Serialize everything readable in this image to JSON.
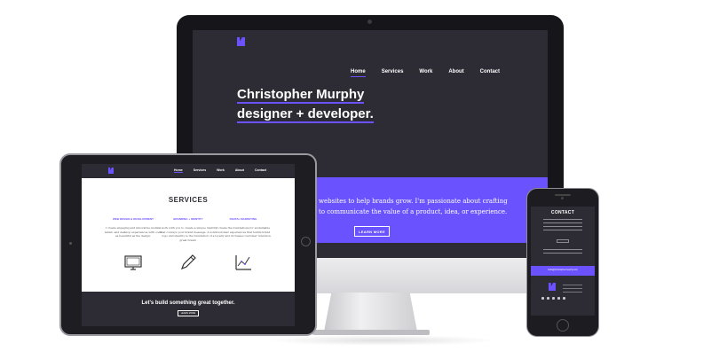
{
  "desktop": {
    "nav": [
      "Home",
      "Services",
      "Work",
      "About",
      "Contact"
    ],
    "hero_line1": "Christopher Murphy",
    "hero_line2": "designer + developer.",
    "band_line1": "websites to help brands grow. I'm passionate about crafting",
    "band_line2": "to communicate the value of a product, idea, or experience.",
    "button": "LEARN MORE"
  },
  "tablet": {
    "nav": [
      "Home",
      "Services",
      "Work",
      "About",
      "Contact"
    ],
    "section_title": "SERVICES",
    "services": [
      {
        "heading": "WEB DESIGN & DEVELOPMENT",
        "text": "I create engaging and innovative mobile, tablet, and desktop experiences with code as beautiful as the design.",
        "icon": "monitor-icon"
      },
      {
        "heading": "BRANDING + IDENTITY",
        "text": "I work with you to create a unique identity that conveys your brand message. A solid logo and identity is the foundation of a great brand.",
        "icon": "pencil-icon"
      },
      {
        "heading": "DIGITAL MARKETING",
        "text": "I create the foundations for sustainable customer experiences that builds brand loyalty and increases customer retention.",
        "icon": "chart-icon"
      }
    ],
    "cta": "Let's build something great together.",
    "button": "LEARN MORE"
  },
  "phone": {
    "section_title": "CONTACT",
    "email": "hello@christophermurphy.com"
  },
  "colors": {
    "accent": "#6a52ff",
    "dark": "#2d2b33"
  }
}
